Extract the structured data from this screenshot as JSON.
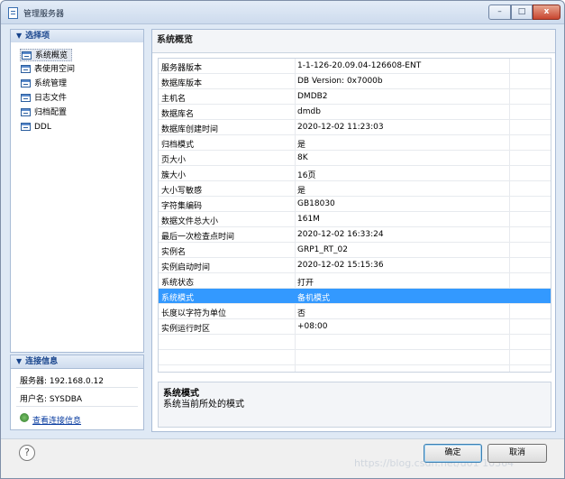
{
  "window": {
    "title": "管理服务器",
    "buttons": {
      "minimize": "–",
      "maximize": "□",
      "close": "x"
    }
  },
  "options": {
    "title": "选择项",
    "items": [
      {
        "label": "系统概览",
        "selected": true
      },
      {
        "label": "表使用空间"
      },
      {
        "label": "系统管理"
      },
      {
        "label": "日志文件"
      },
      {
        "label": "归档配置"
      },
      {
        "label": "DDL"
      }
    ]
  },
  "connection": {
    "title": "连接信息",
    "server": "服务器: 192.168.0.12",
    "user": "用户名: SYSDBA",
    "link": "查看连接信息"
  },
  "overview": {
    "title": "系统概览",
    "rows": [
      {
        "key": "服务器版本",
        "value": "1-1-126-20.09.04-126608-ENT"
      },
      {
        "key": "数据库版本",
        "value": "DB Version: 0x7000b"
      },
      {
        "key": "主机名",
        "value": "DMDB2"
      },
      {
        "key": "数据库名",
        "value": "dmdb"
      },
      {
        "key": "数据库创建时间",
        "value": "2020-12-02 11:23:03"
      },
      {
        "key": "归档模式",
        "value": "是"
      },
      {
        "key": "页大小",
        "value": "8K"
      },
      {
        "key": "簇大小",
        "value": "16页"
      },
      {
        "key": "大小写敏感",
        "value": "是"
      },
      {
        "key": "字符集编码",
        "value": "GB18030"
      },
      {
        "key": "数据文件总大小",
        "value": "161M"
      },
      {
        "key": "最后一次检查点时间",
        "value": "2020-12-02 16:33:24"
      },
      {
        "key": "实例名",
        "value": "GRP1_RT_02"
      },
      {
        "key": "实例启动时间",
        "value": "2020-12-02 15:15:36"
      },
      {
        "key": "系统状态",
        "value": "打开"
      },
      {
        "key": "系统模式",
        "value": "备机模式",
        "selected": true
      },
      {
        "key": "长度以字符为单位",
        "value": "否"
      },
      {
        "key": "实例运行时区",
        "value": "+08:00"
      }
    ],
    "description": {
      "title": "系统模式",
      "text": "系统当前所处的模式"
    }
  },
  "footer": {
    "help": "?",
    "ok": "确定",
    "cancel": "取消"
  },
  "watermark": "https://blog.csdn.net/u01 10364",
  "colors": {
    "selection": "#3399ff",
    "panel_border": "#a9bcd6",
    "link": "#0a3da0"
  }
}
